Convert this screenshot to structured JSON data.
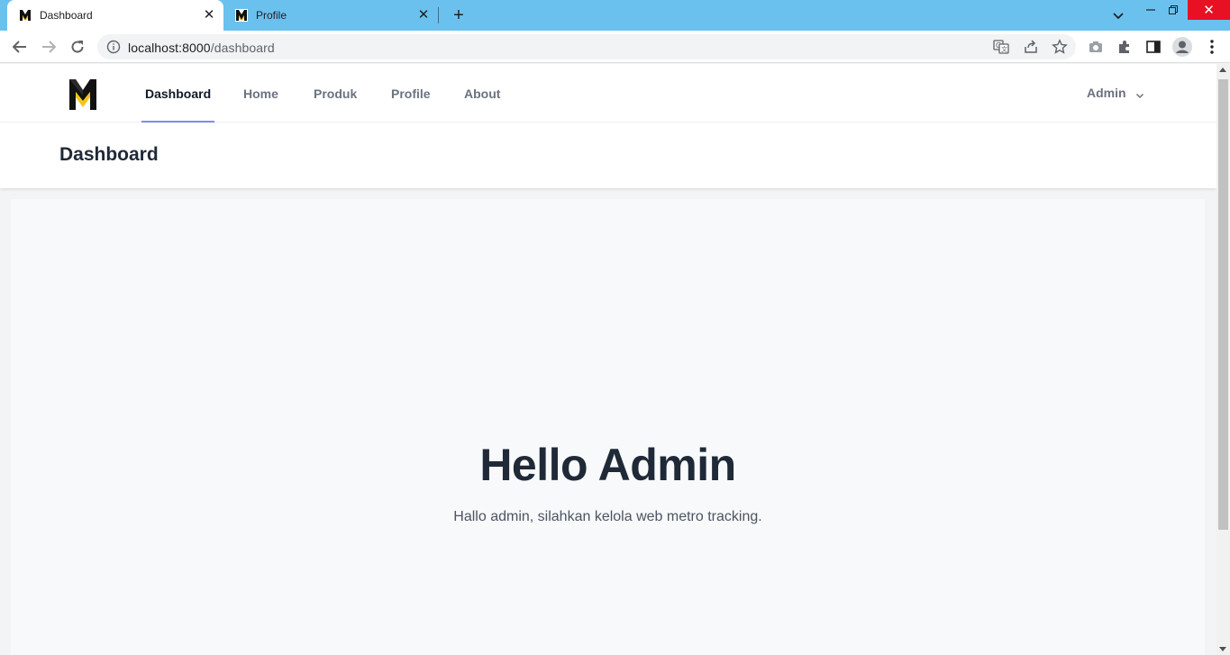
{
  "browser": {
    "tabs": [
      {
        "title": "Dashboard",
        "active": true
      },
      {
        "title": "Profile",
        "active": false
      }
    ],
    "url_host": "localhost:8000",
    "url_path": "/dashboard"
  },
  "nav": {
    "links": [
      "Dashboard",
      "Home",
      "Produk",
      "Profile",
      "About"
    ],
    "active_link": "Dashboard",
    "user_name": "Admin"
  },
  "header": {
    "title": "Dashboard"
  },
  "hero": {
    "title": "Hello Admin",
    "subtitle": "Hallo admin, silahkan kelola web metro tracking."
  },
  "colors": {
    "tabstrip": "#6bc1ee",
    "active_underline": "#818cf8",
    "heading": "#1f2937",
    "close_button": "#e81123"
  }
}
